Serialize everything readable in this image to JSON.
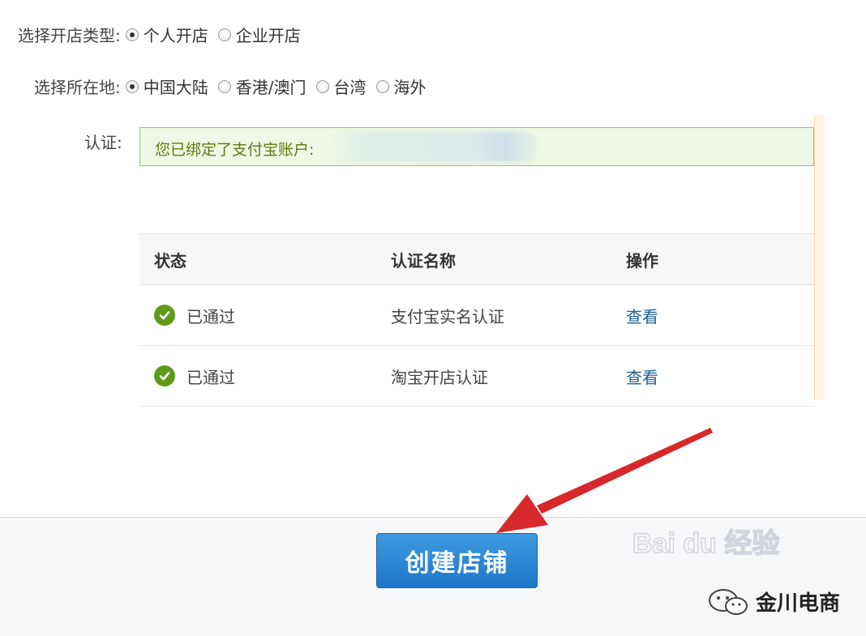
{
  "shop_type": {
    "label": "选择开店类型:",
    "options": [
      {
        "label": "个人开店",
        "selected": true
      },
      {
        "label": "企业开店",
        "selected": false
      }
    ]
  },
  "location": {
    "label": "选择所在地:",
    "options": [
      {
        "label": "中国大陆",
        "selected": true
      },
      {
        "label": "香港/澳门",
        "selected": false
      },
      {
        "label": "台湾",
        "selected": false
      },
      {
        "label": "海外",
        "selected": false
      }
    ]
  },
  "auth": {
    "label": "认证:",
    "notice": "您已绑定了支付宝账户:"
  },
  "table": {
    "headers": [
      "状态",
      "认证名称",
      "操作"
    ],
    "rows": [
      {
        "status": "已通过",
        "name": "支付宝实名认证",
        "action": "查看"
      },
      {
        "status": "已通过",
        "name": "淘宝开店认证",
        "action": "查看"
      }
    ]
  },
  "create_button": "创建店铺",
  "watermark": "Bai du 经验",
  "brand": "金川电商",
  "colors": {
    "accent_button": "#2a86d3",
    "success_green": "#5f9a1c",
    "link_blue": "#1f5f94",
    "arrow_red": "#d7282a"
  }
}
